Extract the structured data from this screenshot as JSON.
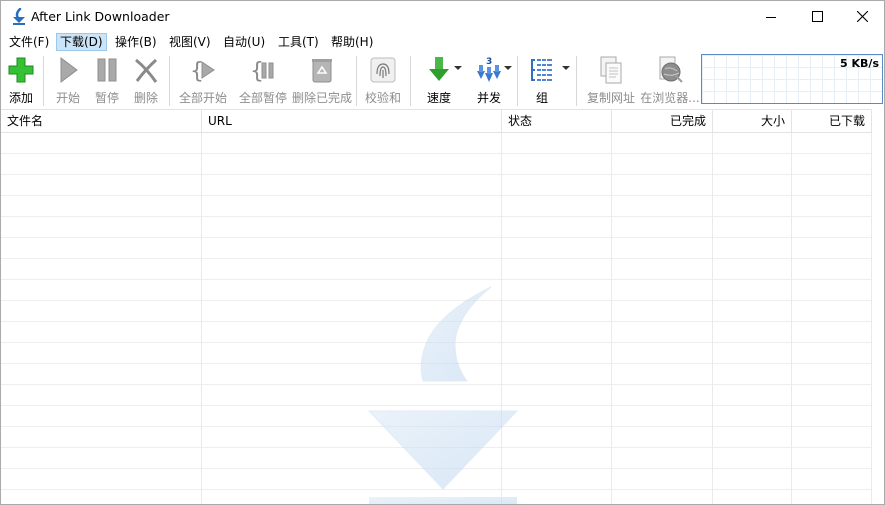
{
  "window": {
    "title": "After Link Downloader"
  },
  "menu": [
    "文件(F)",
    "下载(D)",
    "操作(B)",
    "视图(V)",
    "自动(U)",
    "工具(T)",
    "帮助(H)"
  ],
  "toolbar": {
    "add": "添加",
    "start": "开始",
    "pause": "暂停",
    "delete": "删除",
    "start_all": "全部开始",
    "pause_all": "全部暂停",
    "delete_completed": "删除已完成",
    "checksum": "校验和",
    "speed": "速度",
    "concurrent": "并发",
    "group": "组",
    "copy_url": "复制网址",
    "open_browser": "在浏览器...",
    "concurrent_badge": "3"
  },
  "speed_readout": "5 KB/s",
  "columns": [
    "文件名",
    "URL",
    "状态",
    "已完成",
    "大小",
    "已下载"
  ],
  "colors": {
    "accent": "#5a8ac6",
    "menu_highlight": "#cce4f7",
    "add_green": "#2fb52f"
  }
}
